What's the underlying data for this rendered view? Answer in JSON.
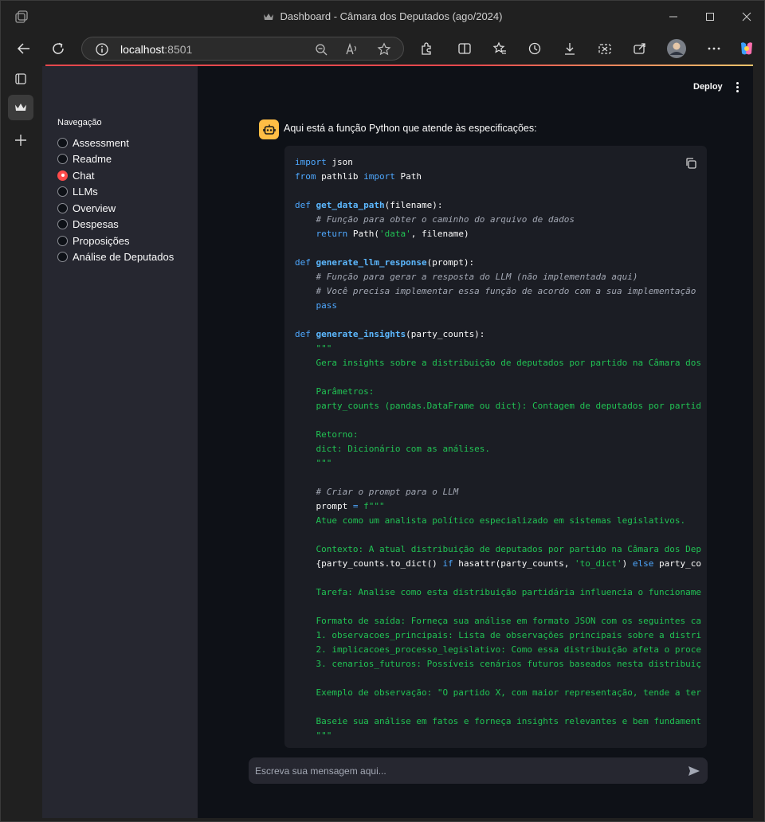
{
  "window": {
    "title": "Dashboard - Câmara dos Deputados (ago/2024)",
    "controls": [
      "minimize",
      "maximize",
      "close"
    ]
  },
  "browser": {
    "url_host": "localhost",
    "url_port": ":8501",
    "nav_icons": [
      "back-icon",
      "reload-icon",
      "info-icon",
      "zoom-out-icon",
      "read-aloud-icon",
      "favorite-icon",
      "extensions-icon",
      "split-screen-icon",
      "favorites-icon",
      "history-icon",
      "downloads-icon",
      "screenshot-icon",
      "share-icon",
      "profile-avatar",
      "more-icon",
      "copilot-icon"
    ]
  },
  "streamlit": {
    "deploy_label": "Deploy",
    "sidebar": {
      "title": "Navegação",
      "options": [
        {
          "label": "Assessment",
          "selected": false
        },
        {
          "label": "Readme",
          "selected": false
        },
        {
          "label": "Chat",
          "selected": true
        },
        {
          "label": "LLMs",
          "selected": false
        },
        {
          "label": "Overview",
          "selected": false
        },
        {
          "label": "Despesas",
          "selected": false
        },
        {
          "label": "Proposições",
          "selected": false
        },
        {
          "label": "Análise de Deputados",
          "selected": false
        }
      ]
    },
    "chat": {
      "intro": "Aqui está a função Python que atende às especificações:",
      "input_placeholder": "Escreva sua mensagem aqui...",
      "code_lines": [
        [
          [
            "kw",
            "import"
          ],
          [
            "t",
            " json"
          ]
        ],
        [
          [
            "kw",
            "from"
          ],
          [
            "t",
            " pathlib "
          ],
          [
            "kw",
            "import"
          ],
          [
            "t",
            " Path"
          ]
        ],
        [],
        [
          [
            "kw",
            "def"
          ],
          [
            "t",
            " "
          ],
          [
            "fn",
            "get_data_path"
          ],
          [
            "t",
            "(filename):"
          ]
        ],
        [
          [
            "t",
            "    "
          ],
          [
            "cm",
            "# Função para obter o caminho do arquivo de dados"
          ]
        ],
        [
          [
            "t",
            "    "
          ],
          [
            "kw",
            "return"
          ],
          [
            "t",
            " Path("
          ],
          [
            "st",
            "'data'"
          ],
          [
            "t",
            ", filename)"
          ]
        ],
        [],
        [
          [
            "kw",
            "def"
          ],
          [
            "t",
            " "
          ],
          [
            "fn",
            "generate_llm_response"
          ],
          [
            "t",
            "(prompt):"
          ]
        ],
        [
          [
            "t",
            "    "
          ],
          [
            "cm",
            "# Função para gerar a resposta do LLM (não implementada aqui)"
          ]
        ],
        [
          [
            "t",
            "    "
          ],
          [
            "cm",
            "# Você precisa implementar essa função de acordo com a sua implementação"
          ]
        ],
        [
          [
            "t",
            "    "
          ],
          [
            "kw",
            "pass"
          ]
        ],
        [],
        [
          [
            "kw",
            "def"
          ],
          [
            "t",
            " "
          ],
          [
            "fn",
            "generate_insights"
          ],
          [
            "t",
            "(party_counts):"
          ]
        ],
        [
          [
            "t",
            "    "
          ],
          [
            "st",
            "\"\"\""
          ]
        ],
        [
          [
            "t",
            "    "
          ],
          [
            "st",
            "Gera insights sobre a distribuição de deputados por partido na Câmara dos"
          ]
        ],
        [],
        [
          [
            "t",
            "    "
          ],
          [
            "st",
            "Parâmetros:"
          ]
        ],
        [
          [
            "t",
            "    "
          ],
          [
            "st",
            "party_counts (pandas.DataFrame ou dict): Contagem de deputados por partid"
          ]
        ],
        [],
        [
          [
            "t",
            "    "
          ],
          [
            "st",
            "Retorno:"
          ]
        ],
        [
          [
            "t",
            "    "
          ],
          [
            "st",
            "dict: Dicionário com as análises."
          ]
        ],
        [
          [
            "t",
            "    "
          ],
          [
            "st",
            "\"\"\""
          ]
        ],
        [],
        [
          [
            "t",
            "    "
          ],
          [
            "cm",
            "# Criar o prompt para o LLM"
          ]
        ],
        [
          [
            "t",
            "    prompt "
          ],
          [
            "kw",
            "="
          ],
          [
            "t",
            " "
          ],
          [
            "st",
            "f\"\"\""
          ]
        ],
        [
          [
            "t",
            "    "
          ],
          [
            "st",
            "Atue como um analista político especializado em sistemas legislativos."
          ]
        ],
        [],
        [
          [
            "t",
            "    "
          ],
          [
            "st",
            "Contexto: A atual distribuição de deputados por partido na Câmara dos Dep"
          ]
        ],
        [
          [
            "t",
            "    {party_counts.to_dict() "
          ],
          [
            "kw",
            "if"
          ],
          [
            "t",
            " hasattr(party_counts, "
          ],
          [
            "st",
            "'to_dict'"
          ],
          [
            "t",
            ") "
          ],
          [
            "kw",
            "else"
          ],
          [
            "t",
            " party_co"
          ]
        ],
        [],
        [
          [
            "t",
            "    "
          ],
          [
            "st",
            "Tarefa: Analise como esta distribuição partidária influencia o funcioname"
          ]
        ],
        [],
        [
          [
            "t",
            "    "
          ],
          [
            "st",
            "Formato de saída: Forneça sua análise em formato JSON com os seguintes ca"
          ]
        ],
        [
          [
            "t",
            "    "
          ],
          [
            "st",
            "1. observacoes_principais: Lista de observações principais sobre a distri"
          ]
        ],
        [
          [
            "t",
            "    "
          ],
          [
            "st",
            "2. implicacoes_processo_legislativo: Como essa distribuição afeta o proce"
          ]
        ],
        [
          [
            "t",
            "    "
          ],
          [
            "st",
            "3. cenarios_futuros: Possíveis cenários futuros baseados nesta distribuiç"
          ]
        ],
        [],
        [
          [
            "t",
            "    "
          ],
          [
            "st",
            "Exemplo de observação: \"O partido X, com maior representação, tende a ter"
          ]
        ],
        [],
        [
          [
            "t",
            "    "
          ],
          [
            "st",
            "Baseie sua análise em fatos e forneça insights relevantes e bem fundament"
          ]
        ],
        [
          [
            "t",
            "    "
          ],
          [
            "st",
            "\"\"\""
          ]
        ]
      ]
    }
  },
  "colors": {
    "accent": "#ff4b4b",
    "avatar_bg": "#ffbd45",
    "app_bg": "#0e1117",
    "sidebar_bg": "#262730"
  }
}
